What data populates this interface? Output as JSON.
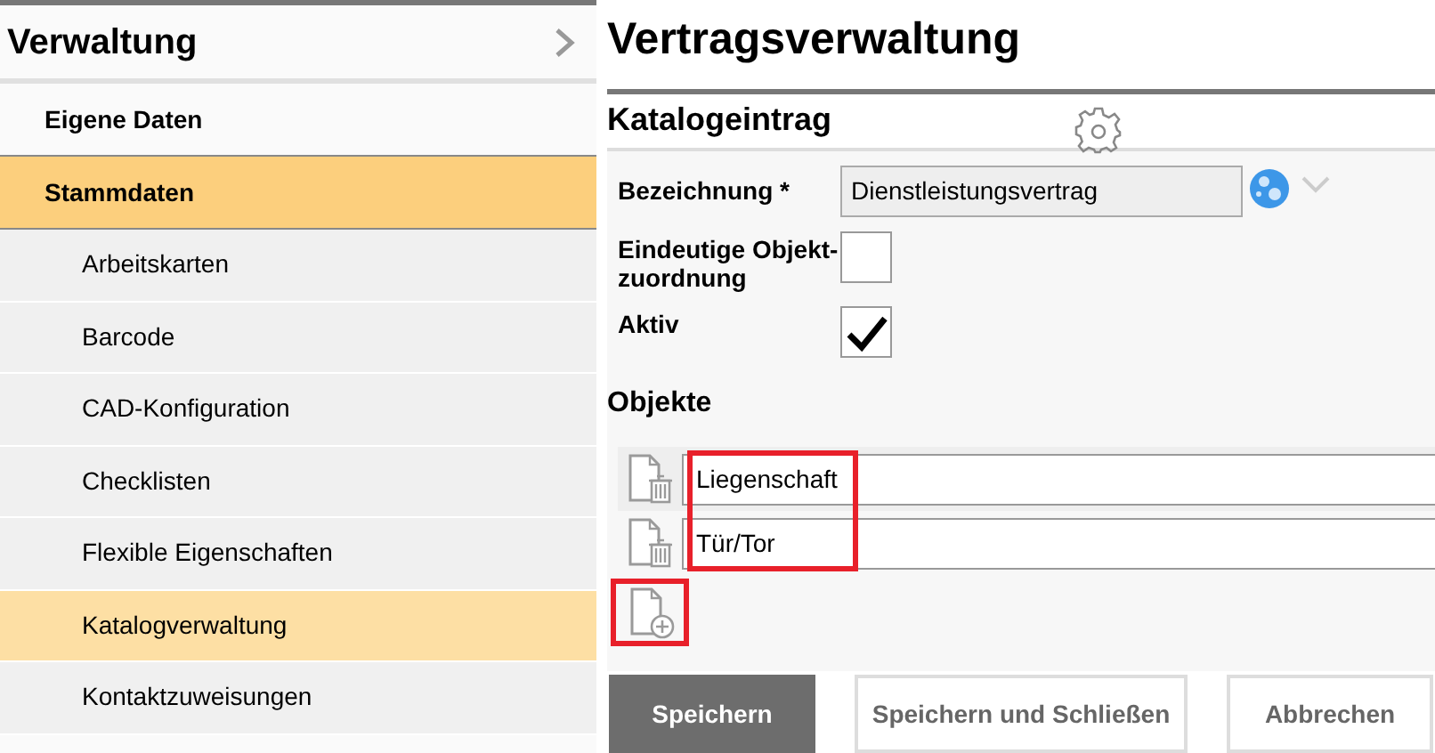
{
  "sidebar": {
    "title": "Verwaltung",
    "items": [
      {
        "label": "Eigene Daten",
        "selected": false
      },
      {
        "label": "Stammdaten",
        "selected": true,
        "children": [
          {
            "label": "Arbeitskarten",
            "selected": false
          },
          {
            "label": "Barcode",
            "selected": false
          },
          {
            "label": "CAD-Konfiguration",
            "selected": false
          },
          {
            "label": "Checklisten",
            "selected": false
          },
          {
            "label": "Flexible Eigenschaften",
            "selected": false
          },
          {
            "label": "Katalogverwaltung",
            "selected": true
          },
          {
            "label": "Kontaktzuweisungen",
            "selected": false
          }
        ]
      }
    ]
  },
  "page_title": "Vertragsverwaltung",
  "section_title": "Katalogeintrag",
  "form": {
    "name_label": "Bezeichnung *",
    "name_value": "Dienstleistungsvertrag",
    "unique_label": "Eindeutige Objekt-zuordnung",
    "unique_checked": false,
    "active_label": "Aktiv",
    "active_checked": true
  },
  "objects": {
    "title": "Objekte",
    "highlighted": true,
    "add_highlighted": true,
    "rows": [
      {
        "value": "Liegenschaft"
      },
      {
        "value": "Tür/Tor"
      }
    ]
  },
  "buttons": [
    {
      "label": "Speichern",
      "kind": "primary"
    },
    {
      "label": "Speichern und Schließen",
      "kind": "secondary"
    },
    {
      "label": "Abbrechen",
      "kind": "secondary"
    }
  ]
}
